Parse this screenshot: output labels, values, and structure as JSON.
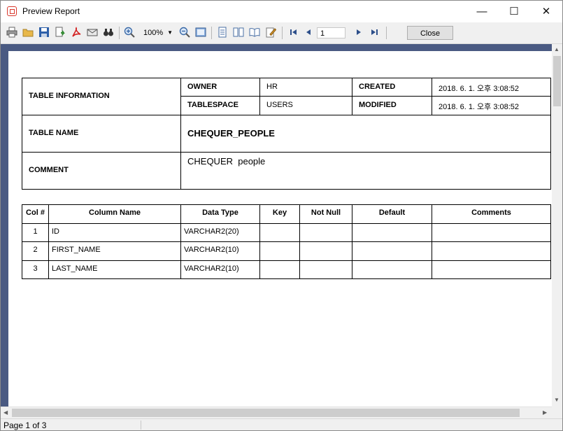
{
  "window": {
    "title": "Preview Report",
    "controls": {
      "minimize": "—",
      "maximize": "☐",
      "close": "✕"
    }
  },
  "toolbar": {
    "icons": [
      "printer-icon",
      "open-folder-icon",
      "save-disk-icon",
      "export-icon",
      "pdf-icon",
      "email-icon",
      "find-binoculars-icon",
      "zoom-in-icon",
      "zoom-out-icon",
      "whole-page-icon",
      "single-page-icon",
      "two-pages-icon",
      "book-icon",
      "edit-icon",
      "first-page-icon",
      "previous-page-icon",
      "next-page-icon",
      "last-page-icon"
    ],
    "zoom_value": "100%",
    "page_value": "1",
    "close_label": "Close"
  },
  "info_table": {
    "table_information_label": "TABLE INFORMATION",
    "owner_label": "OWNER",
    "owner_value": "HR",
    "created_label": "CREATED",
    "created_value": "2018. 6. 1. 오후 3:08:52",
    "tablespace_label": "TABLESPACE",
    "tablespace_value": "USERS",
    "modified_label": "MODIFIED",
    "modified_value": "2018. 6. 1. 오후 3:08:52",
    "table_name_label": "TABLE NAME",
    "table_name_value": "CHEQUER_PEOPLE",
    "comment_label": "COMMENT",
    "comment_value": "CHEQUER  people"
  },
  "columns_table": {
    "headers": [
      "Col #",
      "Column Name",
      "Data Type",
      "Key",
      "Not Null",
      "Default",
      "Comments"
    ],
    "rows": [
      [
        "1",
        "ID",
        "VARCHAR2(20)",
        "",
        "",
        "",
        ""
      ],
      [
        "2",
        "FIRST_NAME",
        "VARCHAR2(10)",
        "",
        "",
        "",
        ""
      ],
      [
        "3",
        "LAST_NAME",
        "VARCHAR2(10)",
        "",
        "",
        "",
        ""
      ]
    ]
  },
  "status": {
    "page_info": "Page 1 of 3"
  }
}
